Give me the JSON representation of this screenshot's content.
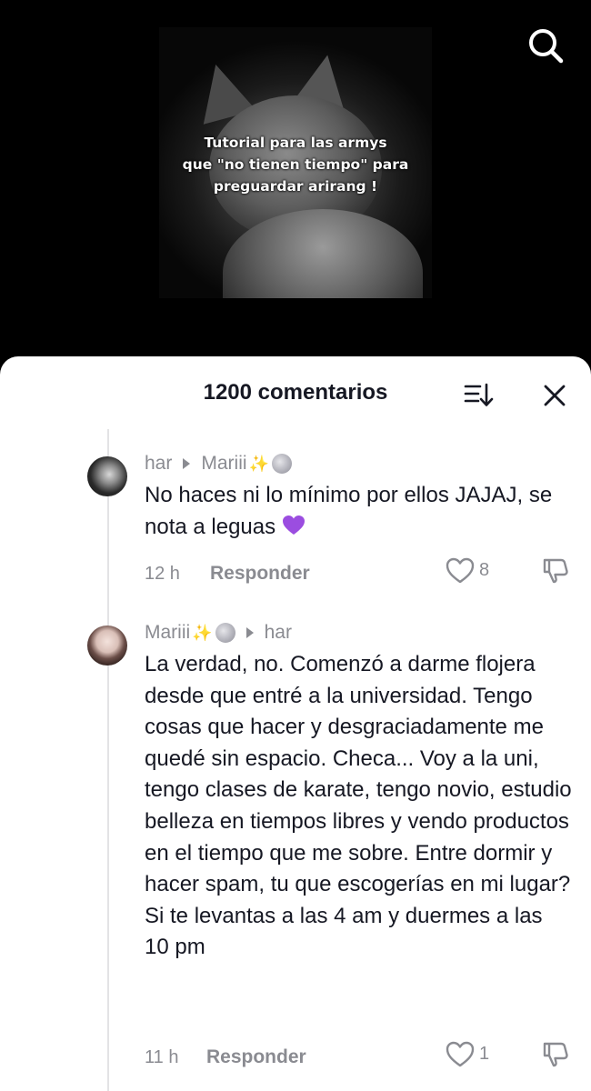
{
  "video": {
    "caption_line1": "Tutorial para las armys",
    "caption_line2": "que \"no tienen tiempo\" para",
    "caption_line3": "preguardar arirang !"
  },
  "comments_panel": {
    "title": "1200 comentarios",
    "sort_icon": "sort-icon",
    "close_icon": "close-icon"
  },
  "comments": [
    {
      "author": "har",
      "reply_to": "Mariii",
      "reply_to_decorations": [
        "sparkles-emoji",
        "moon-emoji"
      ],
      "text": "No haces ni lo mínimo por ellos JAJAJ, se nota a leguas",
      "trailing_emoji": "purple-heart-emoji",
      "time": "12 h",
      "reply_label": "Responder",
      "likes": "8"
    },
    {
      "author": "Mariii",
      "author_decorations": [
        "sparkles-emoji",
        "moon-emoji"
      ],
      "reply_to": "har",
      "text": "La verdad, no. Comenzó a darme flojera desde que entré a la universidad. Tengo cosas que hacer y desgraciadamente me quedé sin espacio. Checa... Voy a la uni, tengo clases de karate, tengo novio, estudio belleza en tiempos libres y vendo productos en el tiempo que me sobre. Entre dormir y hacer spam, tu que escogerías en mi lugar? Si te levantas a las 4 am y duermes a las 10 pm",
      "time": "11 h",
      "reply_label": "Responder",
      "likes": "1"
    }
  ],
  "colors": {
    "text_primary": "#161823",
    "text_secondary": "#8a8b91",
    "panel_bg": "#ffffff",
    "video_bg": "#000000",
    "heart_emoji": "#9b4de0"
  }
}
